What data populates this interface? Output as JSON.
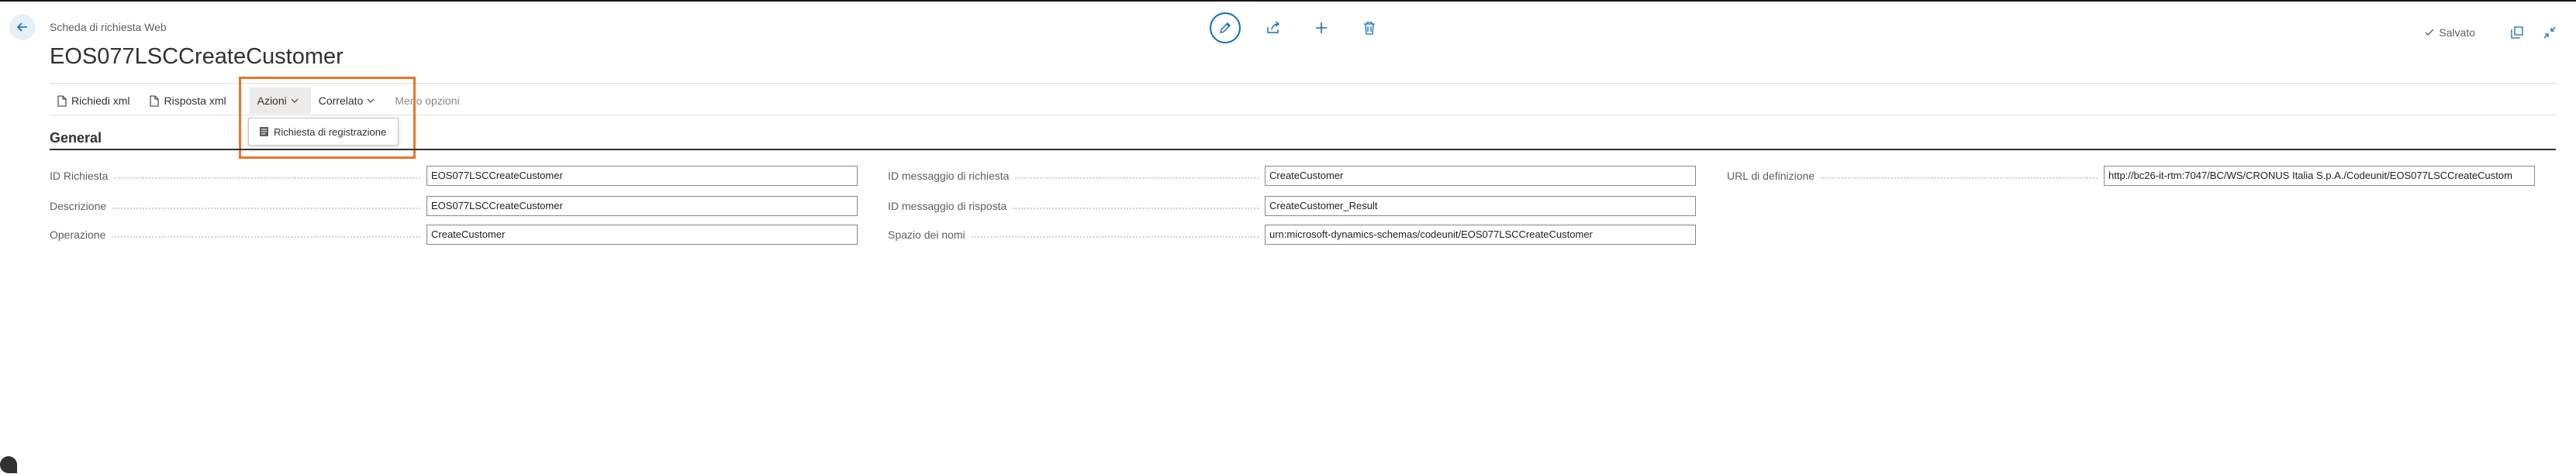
{
  "header": {
    "caption": "Scheda di richiesta Web",
    "title": "EOS077LSCCreateCustomer",
    "saved_label": "Salvato"
  },
  "toolbar": {
    "request_xml": "Richiedi xml",
    "response_xml": "Risposta xml",
    "actions": "Azioni",
    "related": "Correlato",
    "fewer_options": "Meno opzioni"
  },
  "dropdown": {
    "item": "Richiesta di registrazione"
  },
  "section": {
    "title": "General"
  },
  "fields": {
    "col1": [
      {
        "label": "ID Richiesta",
        "value": "EOS077LSCCreateCustomer"
      },
      {
        "label": "Descrizione",
        "value": "EOS077LSCCreateCustomer"
      },
      {
        "label": "Operazione",
        "value": "CreateCustomer"
      }
    ],
    "col2": [
      {
        "label": "ID messaggio di richiesta",
        "value": "CreateCustomer"
      },
      {
        "label": "ID messaggio di risposta",
        "value": "CreateCustomer_Result"
      },
      {
        "label": "Spazio dei nomi",
        "value": "urn:microsoft-dynamics-schemas/codeunit/EOS077LSCCreateCustomer"
      }
    ],
    "col3": [
      {
        "label": "URL di definizione",
        "value": "http://bc26-it-rtm:7047/BC/WS/CRONUS Italia S.p.A./Codeunit/EOS077LSCCreateCustom"
      }
    ]
  },
  "colors": {
    "accent": "#0f6cbd",
    "highlight": "#e8762b"
  }
}
